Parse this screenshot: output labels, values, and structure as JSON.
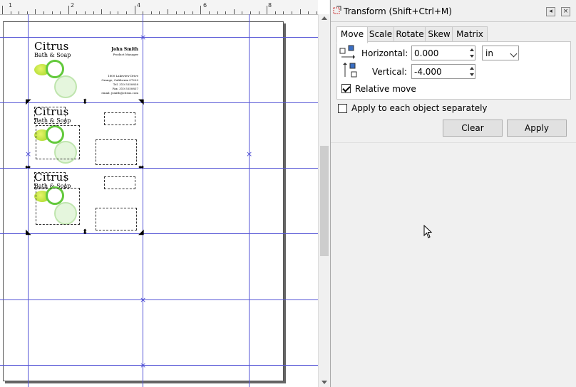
{
  "ruler": {
    "labels": [
      "1",
      "2",
      "4",
      "6",
      "8"
    ]
  },
  "card": {
    "brand": "Citrus",
    "brand_sub": "Bath & Soap",
    "name": "John Smith",
    "title": "Product Manager",
    "address_lines": [
      "1800 Lakeview Drive",
      "Orange, California 07220",
      "Tel. 310 5550838",
      "Fax. 310 5550837",
      "email. jsmith@citrus.com"
    ]
  },
  "panel": {
    "title": "Transform (Shift+Ctrl+M)",
    "tabs": [
      "Move",
      "Scale",
      "Rotate",
      "Skew",
      "Matrix"
    ],
    "horizontal_label": "Horizontal:",
    "horizontal_value": "0.000",
    "unit": "in",
    "vertical_label": "Vertical:",
    "vertical_value": "-4.000",
    "relative_move_label": "Relative move",
    "relative_move_checked": true,
    "apply_each_label": "Apply to each object separately",
    "apply_each_checked": false,
    "clear_label": "Clear",
    "apply_label": "Apply"
  },
  "colors": {
    "guide": "#5656d6",
    "lime_green": "#63c93c",
    "panel_bg": "#f0f0f0"
  }
}
